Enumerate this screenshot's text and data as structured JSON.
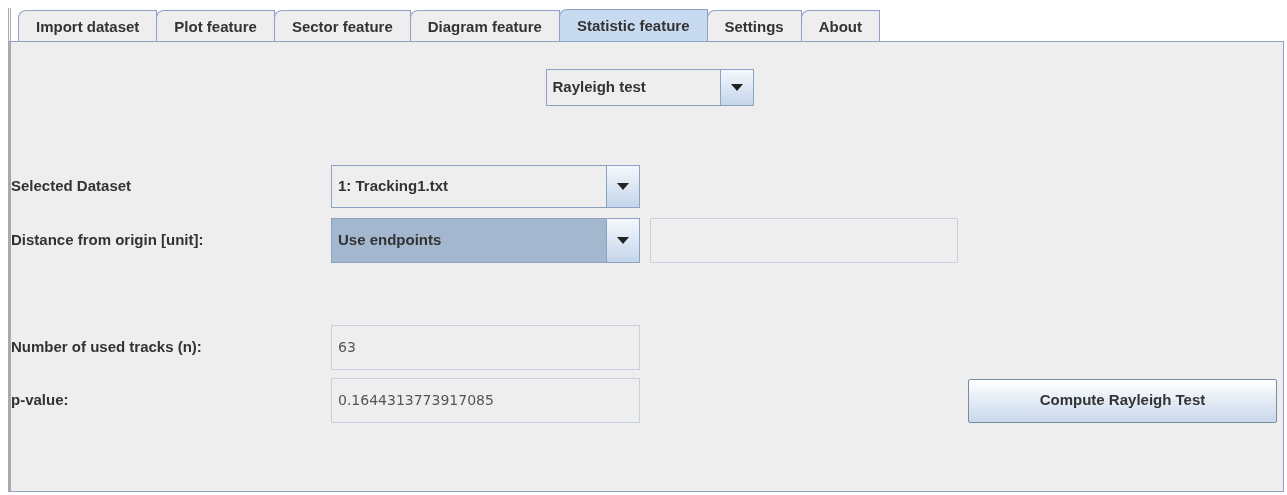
{
  "tabs": [
    {
      "label": "Import dataset",
      "selected": false
    },
    {
      "label": "Plot feature",
      "selected": false
    },
    {
      "label": "Sector feature",
      "selected": false
    },
    {
      "label": "Diagram feature",
      "selected": false
    },
    {
      "label": "Statistic feature",
      "selected": true
    },
    {
      "label": "Settings",
      "selected": false
    },
    {
      "label": "About",
      "selected": false
    }
  ],
  "test_dropdown": {
    "value": "Rayleigh test"
  },
  "dataset_row": {
    "label": "Selected Dataset",
    "value": "1: Tracking1.txt",
    "focused": false
  },
  "distance_row": {
    "label": "Distance from origin [unit]:",
    "value": "Use endpoints",
    "focused": true
  },
  "results": [
    {
      "label": "Number of used tracks (n):",
      "value": "63"
    },
    {
      "label": "p-value:",
      "value": "0.1644313773917085"
    }
  ],
  "compute_button": {
    "label": "Compute Rayleigh Test"
  }
}
